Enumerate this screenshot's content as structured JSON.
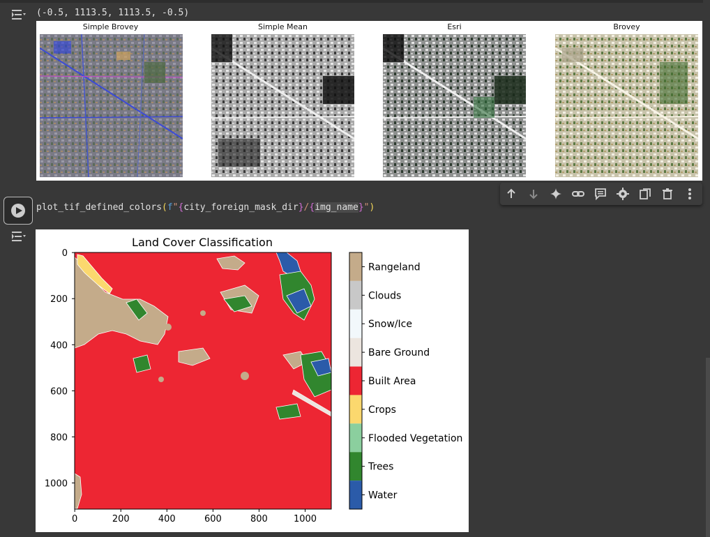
{
  "output1": {
    "axis_tuple": "(-0.5, 1113.5, 1113.5, -0.5)",
    "subplots": [
      {
        "title": "Simple Brovey"
      },
      {
        "title": "Simple Mean"
      },
      {
        "title": "Esri"
      },
      {
        "title": "Brovey"
      }
    ]
  },
  "toolbar": {
    "icons": [
      "move-up-icon",
      "move-down-icon",
      "sparkle-icon",
      "link-icon",
      "comment-icon",
      "gear-icon",
      "mirror-cell-icon",
      "trash-icon",
      "more-vert-icon"
    ]
  },
  "code_cell": {
    "fn": "plot_tif_defined_colors",
    "open": "(",
    "fprefix": "f",
    "q1": "\"",
    "b1o": "{",
    "var1": "city_foreign_mask_dir",
    "b1c": "}",
    "slash": "/",
    "b2o": "{",
    "var2": "img_name",
    "b2c": "}",
    "q2": "\"",
    "close": ")"
  },
  "chart_data": {
    "type": "heatmap",
    "title": "Land Cover Classification",
    "xlabel": "",
    "ylabel": "",
    "xlim": [
      -0.5,
      1113.5
    ],
    "ylim": [
      1113.5,
      -0.5
    ],
    "xticks": [
      "0",
      "200",
      "400",
      "600",
      "800",
      "1000"
    ],
    "yticks": [
      "0",
      "200",
      "400",
      "600",
      "800",
      "1000"
    ],
    "legend_position": "right (colorbar)",
    "colorbar_classes": [
      {
        "label": "Rangeland",
        "color": "#c4ab8a"
      },
      {
        "label": "Clouds",
        "color": "#c8c8c8"
      },
      {
        "label": "Snow/Ice",
        "color": "#f2f8fb"
      },
      {
        "label": "Bare Ground",
        "color": "#ece5df"
      },
      {
        "label": "Built Area",
        "color": "#ed2633"
      },
      {
        "label": "Crops",
        "color": "#fbd86e"
      },
      {
        "label": "Flooded Vegetation",
        "color": "#8bcf9e"
      },
      {
        "label": "Trees",
        "color": "#31862e"
      },
      {
        "label": "Water",
        "color": "#2b5ba9"
      }
    ],
    "dominant_class": "Built Area"
  }
}
